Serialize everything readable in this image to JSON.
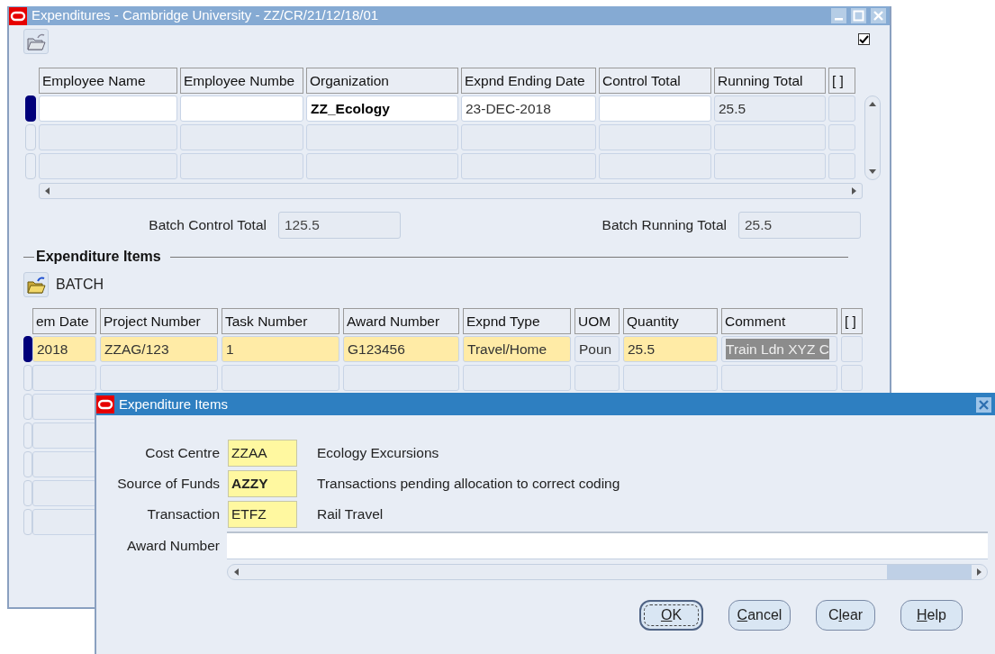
{
  "window": {
    "title": "Expenditures - Cambridge University - ZZ/CR/21/12/18/01",
    "active": false
  },
  "header_checkbox": {
    "checked": true
  },
  "batches": {
    "columns": [
      "Employee Name",
      "Employee Numbe",
      "Organization",
      "Expnd Ending Date",
      "Control Total",
      "Running Total",
      "[ ]"
    ],
    "rows": [
      {
        "selected": true,
        "cells": [
          {
            "kind": "editable"
          },
          {
            "kind": "editable"
          },
          {
            "kind": "editable",
            "value": "ZZ_Ecology",
            "bold": true
          },
          {
            "kind": "editable",
            "value": "23-DEC-2018"
          },
          {
            "kind": "editable"
          },
          {
            "kind": "readonly",
            "value": "25.5"
          },
          {
            "kind": "readonly"
          }
        ]
      },
      {
        "selected": false
      },
      {
        "selected": false
      }
    ]
  },
  "batch_control_total": {
    "label": "Batch Control Total",
    "value": "125.5"
  },
  "batch_running_total": {
    "label": "Batch Running Total",
    "value": "25.5"
  },
  "section_title": "Expenditure Items",
  "batch_button": {
    "label": "BATCH"
  },
  "items": {
    "columns": [
      "em Date",
      "Project Number",
      "Task Number",
      "Award Number",
      "Expnd Type",
      "UOM",
      "Quantity",
      "Comment",
      "[ ]"
    ],
    "rows": [
      {
        "selected": true,
        "cells": [
          {
            "kind": "required",
            "value": "2018"
          },
          {
            "kind": "required",
            "value": "ZZAG/123"
          },
          {
            "kind": "required",
            "value": "1"
          },
          {
            "kind": "required",
            "value": "G123456"
          },
          {
            "kind": "required",
            "value": "Travel/Home"
          },
          {
            "kind": "readonly",
            "value": "Poun"
          },
          {
            "kind": "required",
            "value": "25.5"
          },
          {
            "kind": "highlighted",
            "value": "Train Ldn XYZ C"
          },
          {
            "kind": "readonly"
          }
        ]
      },
      {
        "selected": false
      },
      {
        "selected": false
      },
      {
        "selected": false
      },
      {
        "selected": false
      },
      {
        "selected": false
      },
      {
        "selected": false
      }
    ]
  },
  "dialog": {
    "title": "Expenditure Items",
    "active": true,
    "fields": [
      {
        "label": "Cost Centre",
        "value": "ZZAA",
        "description": "Ecology Excursions"
      },
      {
        "label": "Source of Funds",
        "value": "AZZY",
        "bold": true,
        "description": "Transactions pending allocation to correct coding"
      },
      {
        "label": "Transaction",
        "value": "ETFZ",
        "description": "Rail Travel"
      }
    ],
    "award_number": {
      "label": "Award Number"
    },
    "buttons": [
      {
        "label": "OK",
        "default": true
      },
      {
        "label": "Cancel",
        "default": false
      },
      {
        "label": "Clear",
        "default": false
      },
      {
        "label": "Help",
        "default": false
      }
    ]
  }
}
